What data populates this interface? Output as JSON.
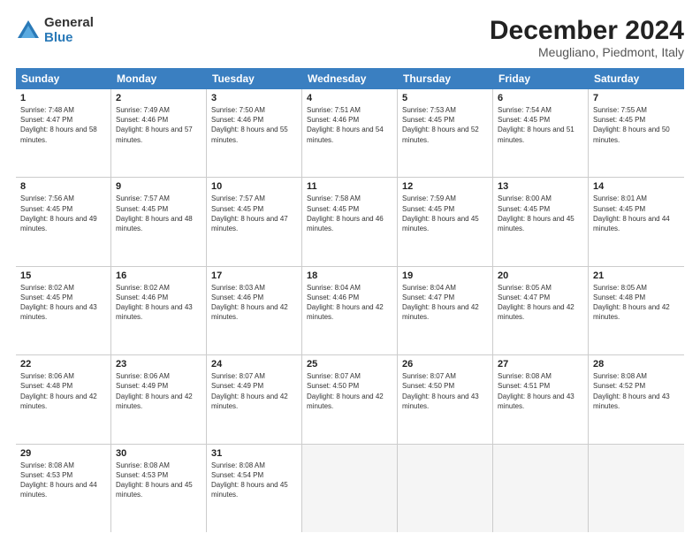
{
  "logo": {
    "general": "General",
    "blue": "Blue"
  },
  "header": {
    "month": "December 2024",
    "location": "Meugliano, Piedmont, Italy"
  },
  "days": [
    "Sunday",
    "Monday",
    "Tuesday",
    "Wednesday",
    "Thursday",
    "Friday",
    "Saturday"
  ],
  "weeks": [
    [
      {
        "day": "1",
        "sunrise": "Sunrise: 7:48 AM",
        "sunset": "Sunset: 4:47 PM",
        "daylight": "Daylight: 8 hours and 58 minutes."
      },
      {
        "day": "2",
        "sunrise": "Sunrise: 7:49 AM",
        "sunset": "Sunset: 4:46 PM",
        "daylight": "Daylight: 8 hours and 57 minutes."
      },
      {
        "day": "3",
        "sunrise": "Sunrise: 7:50 AM",
        "sunset": "Sunset: 4:46 PM",
        "daylight": "Daylight: 8 hours and 55 minutes."
      },
      {
        "day": "4",
        "sunrise": "Sunrise: 7:51 AM",
        "sunset": "Sunset: 4:46 PM",
        "daylight": "Daylight: 8 hours and 54 minutes."
      },
      {
        "day": "5",
        "sunrise": "Sunrise: 7:53 AM",
        "sunset": "Sunset: 4:45 PM",
        "daylight": "Daylight: 8 hours and 52 minutes."
      },
      {
        "day": "6",
        "sunrise": "Sunrise: 7:54 AM",
        "sunset": "Sunset: 4:45 PM",
        "daylight": "Daylight: 8 hours and 51 minutes."
      },
      {
        "day": "7",
        "sunrise": "Sunrise: 7:55 AM",
        "sunset": "Sunset: 4:45 PM",
        "daylight": "Daylight: 8 hours and 50 minutes."
      }
    ],
    [
      {
        "day": "8",
        "sunrise": "Sunrise: 7:56 AM",
        "sunset": "Sunset: 4:45 PM",
        "daylight": "Daylight: 8 hours and 49 minutes."
      },
      {
        "day": "9",
        "sunrise": "Sunrise: 7:57 AM",
        "sunset": "Sunset: 4:45 PM",
        "daylight": "Daylight: 8 hours and 48 minutes."
      },
      {
        "day": "10",
        "sunrise": "Sunrise: 7:57 AM",
        "sunset": "Sunset: 4:45 PM",
        "daylight": "Daylight: 8 hours and 47 minutes."
      },
      {
        "day": "11",
        "sunrise": "Sunrise: 7:58 AM",
        "sunset": "Sunset: 4:45 PM",
        "daylight": "Daylight: 8 hours and 46 minutes."
      },
      {
        "day": "12",
        "sunrise": "Sunrise: 7:59 AM",
        "sunset": "Sunset: 4:45 PM",
        "daylight": "Daylight: 8 hours and 45 minutes."
      },
      {
        "day": "13",
        "sunrise": "Sunrise: 8:00 AM",
        "sunset": "Sunset: 4:45 PM",
        "daylight": "Daylight: 8 hours and 45 minutes."
      },
      {
        "day": "14",
        "sunrise": "Sunrise: 8:01 AM",
        "sunset": "Sunset: 4:45 PM",
        "daylight": "Daylight: 8 hours and 44 minutes."
      }
    ],
    [
      {
        "day": "15",
        "sunrise": "Sunrise: 8:02 AM",
        "sunset": "Sunset: 4:45 PM",
        "daylight": "Daylight: 8 hours and 43 minutes."
      },
      {
        "day": "16",
        "sunrise": "Sunrise: 8:02 AM",
        "sunset": "Sunset: 4:46 PM",
        "daylight": "Daylight: 8 hours and 43 minutes."
      },
      {
        "day": "17",
        "sunrise": "Sunrise: 8:03 AM",
        "sunset": "Sunset: 4:46 PM",
        "daylight": "Daylight: 8 hours and 42 minutes."
      },
      {
        "day": "18",
        "sunrise": "Sunrise: 8:04 AM",
        "sunset": "Sunset: 4:46 PM",
        "daylight": "Daylight: 8 hours and 42 minutes."
      },
      {
        "day": "19",
        "sunrise": "Sunrise: 8:04 AM",
        "sunset": "Sunset: 4:47 PM",
        "daylight": "Daylight: 8 hours and 42 minutes."
      },
      {
        "day": "20",
        "sunrise": "Sunrise: 8:05 AM",
        "sunset": "Sunset: 4:47 PM",
        "daylight": "Daylight: 8 hours and 42 minutes."
      },
      {
        "day": "21",
        "sunrise": "Sunrise: 8:05 AM",
        "sunset": "Sunset: 4:48 PM",
        "daylight": "Daylight: 8 hours and 42 minutes."
      }
    ],
    [
      {
        "day": "22",
        "sunrise": "Sunrise: 8:06 AM",
        "sunset": "Sunset: 4:48 PM",
        "daylight": "Daylight: 8 hours and 42 minutes."
      },
      {
        "day": "23",
        "sunrise": "Sunrise: 8:06 AM",
        "sunset": "Sunset: 4:49 PM",
        "daylight": "Daylight: 8 hours and 42 minutes."
      },
      {
        "day": "24",
        "sunrise": "Sunrise: 8:07 AM",
        "sunset": "Sunset: 4:49 PM",
        "daylight": "Daylight: 8 hours and 42 minutes."
      },
      {
        "day": "25",
        "sunrise": "Sunrise: 8:07 AM",
        "sunset": "Sunset: 4:50 PM",
        "daylight": "Daylight: 8 hours and 42 minutes."
      },
      {
        "day": "26",
        "sunrise": "Sunrise: 8:07 AM",
        "sunset": "Sunset: 4:50 PM",
        "daylight": "Daylight: 8 hours and 43 minutes."
      },
      {
        "day": "27",
        "sunrise": "Sunrise: 8:08 AM",
        "sunset": "Sunset: 4:51 PM",
        "daylight": "Daylight: 8 hours and 43 minutes."
      },
      {
        "day": "28",
        "sunrise": "Sunrise: 8:08 AM",
        "sunset": "Sunset: 4:52 PM",
        "daylight": "Daylight: 8 hours and 43 minutes."
      }
    ],
    [
      {
        "day": "29",
        "sunrise": "Sunrise: 8:08 AM",
        "sunset": "Sunset: 4:53 PM",
        "daylight": "Daylight: 8 hours and 44 minutes."
      },
      {
        "day": "30",
        "sunrise": "Sunrise: 8:08 AM",
        "sunset": "Sunset: 4:53 PM",
        "daylight": "Daylight: 8 hours and 45 minutes."
      },
      {
        "day": "31",
        "sunrise": "Sunrise: 8:08 AM",
        "sunset": "Sunset: 4:54 PM",
        "daylight": "Daylight: 8 hours and 45 minutes."
      },
      null,
      null,
      null,
      null
    ]
  ]
}
